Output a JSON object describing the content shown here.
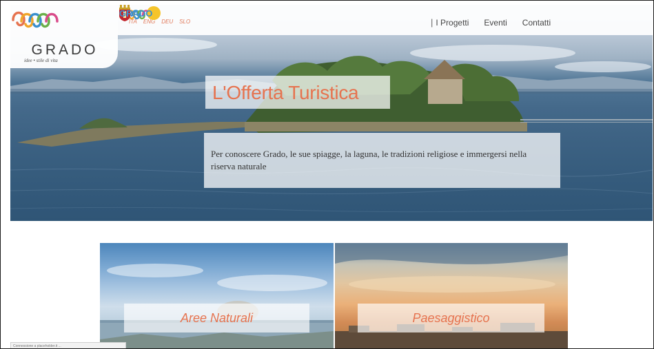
{
  "logo": {
    "name": "GRADO",
    "tagline": "idee • stile di vita",
    "icon": "loops-logo-icon"
  },
  "languages": [
    "ITA",
    "ENG",
    "DEU",
    "SLO"
  ],
  "nav": {
    "projects": "I Progetti",
    "events": "Eventi",
    "contacts": "Contatti",
    "brand": "GRADO"
  },
  "hero": {
    "title": "L'Offerta Turistica",
    "description": "Per conoscere Grado, le sue spiagge, la laguna, le tradizioni religiose e immergersi nella riserva naturale"
  },
  "cards": [
    {
      "label": "Aree Naturali"
    },
    {
      "label": "Paesaggistico"
    }
  ],
  "status": {
    "text": "Connessione a placeholder.it ..."
  },
  "colors": {
    "accent": "#e6734f",
    "sea": "#3d6283",
    "brand_blue": "#3a8fcd"
  }
}
